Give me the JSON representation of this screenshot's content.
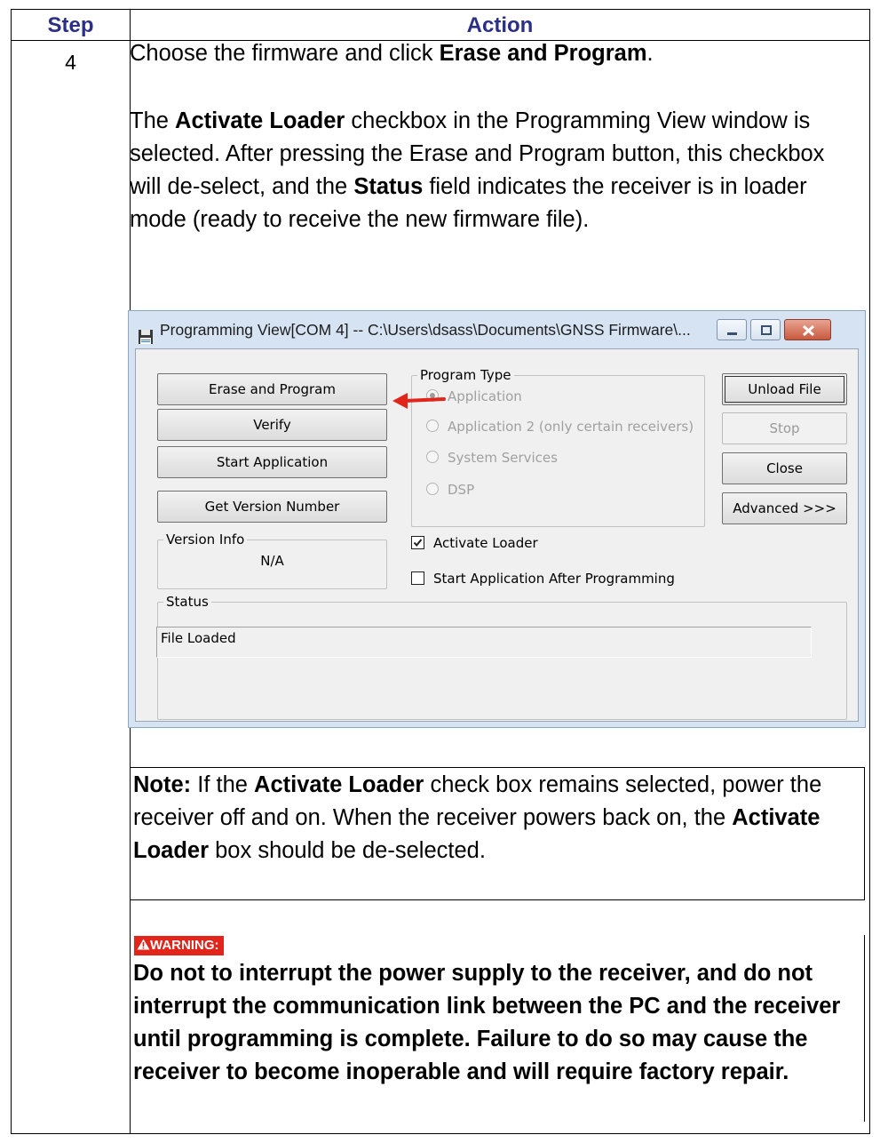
{
  "table": {
    "headers": {
      "step": "Step",
      "action": "Action"
    },
    "step_number": "4"
  },
  "instruction": {
    "intro": "Choose the firmware and click ",
    "intro_bold": "Erase and Program",
    "intro_end": ".",
    "p2_a": "The ",
    "p2_bold1": "Activate Loader",
    "p2_b": " checkbox in the Programming View window is selected. After pressing the Erase and Program button, this checkbox will de-select, and the ",
    "p2_bold2": "Status",
    "p2_c": " field indicates the receiver is in loader mode (ready to receive the new firmware file)."
  },
  "dialog": {
    "title": "Programming View[COM 4] -- C:\\Users\\dsass\\Documents\\GNSS Firmware\\...",
    "buttons": {
      "erase_program": "Erase and Program",
      "verify": "Verify",
      "start_application": "Start Application",
      "get_version": "Get Version Number",
      "unload_file": "Unload File",
      "stop": "Stop",
      "close": "Close",
      "advanced": "Advanced >>>"
    },
    "program_type": {
      "label": "Program Type",
      "options": [
        "Application",
        "Application 2 (only certain receivers)",
        "System Services",
        "DSP"
      ],
      "selected": "Application"
    },
    "version_info": {
      "label": "Version Info",
      "value": "N/A"
    },
    "checkboxes": {
      "activate_loader": {
        "label": "Activate Loader",
        "checked": true
      },
      "start_after": {
        "label": "Start Application After Programming",
        "checked": false
      }
    },
    "status": {
      "label": "Status",
      "value": "File Loaded"
    }
  },
  "note": {
    "label": "Note:",
    "a": " If the ",
    "bold": "Activate Loader",
    "b": " check box remains selected, power the receiver off and on. When the receiver powers back on, the ",
    "bold2": "Activate Loader",
    "c": " box should be de-selected."
  },
  "warning": {
    "badge": "WARNING:",
    "text": "Do not to interrupt the power supply to the receiver, and do not interrupt the communication link between the PC and the receiver until programming is complete. Failure to do so may cause the receiver to become inoperable and will require factory repair."
  },
  "colors": {
    "header_text": "#2b2f88",
    "warning_badge": "#e1251b",
    "arrow": "#e1251b"
  }
}
